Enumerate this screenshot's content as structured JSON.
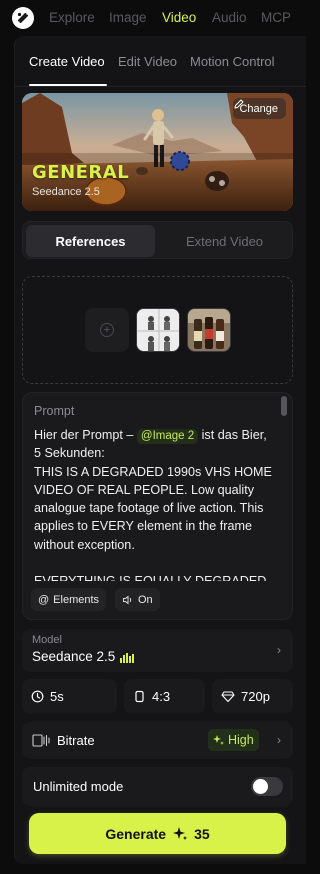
{
  "nav": {
    "items": [
      {
        "label": "Explore"
      },
      {
        "label": "Image"
      },
      {
        "label": "Video"
      },
      {
        "label": "Audio"
      },
      {
        "label": "MCP"
      }
    ],
    "active": "Video"
  },
  "tabs": [
    {
      "label": "Create Video"
    },
    {
      "label": "Edit Video"
    },
    {
      "label": "Motion Control"
    }
  ],
  "hero": {
    "title": "GENERAL",
    "subtitle": "Seedance 2.5",
    "change_label": "Change"
  },
  "segmented": {
    "active": "References",
    "inactive": "Extend Video"
  },
  "prompt": {
    "label": "Prompt",
    "text_before": "Hier der Prompt – ",
    "mention": "@Image 2",
    "text_after": " ist das Bier, 5 Sekunden:\nTHIS IS A DEGRADED 1990s VHS HOME VIDEO OF REAL PEOPLE. Low quality analogue tape footage of live action. This applies to EVERY element in the frame without exception.\n\nEVERYTHING IS EQUALLY DEGRADED",
    "chips": [
      {
        "label": "Elements",
        "icon": "at-icon"
      },
      {
        "label": "On",
        "icon": "speaker-icon"
      }
    ]
  },
  "model": {
    "label": "Model",
    "value": "Seedance 2.5"
  },
  "options": {
    "duration": "5s",
    "aspect": "4:3",
    "resolution": "720p"
  },
  "bitrate": {
    "label": "Bitrate",
    "value": "High"
  },
  "unlimited": {
    "label": "Unlimited mode",
    "enabled": false
  },
  "generate": {
    "label": "Generate",
    "cost": "35"
  },
  "colors": {
    "accent": "#d9f24a",
    "background": "#0c0c0d",
    "panel": "#141416",
    "card": "#1a1a1d"
  }
}
